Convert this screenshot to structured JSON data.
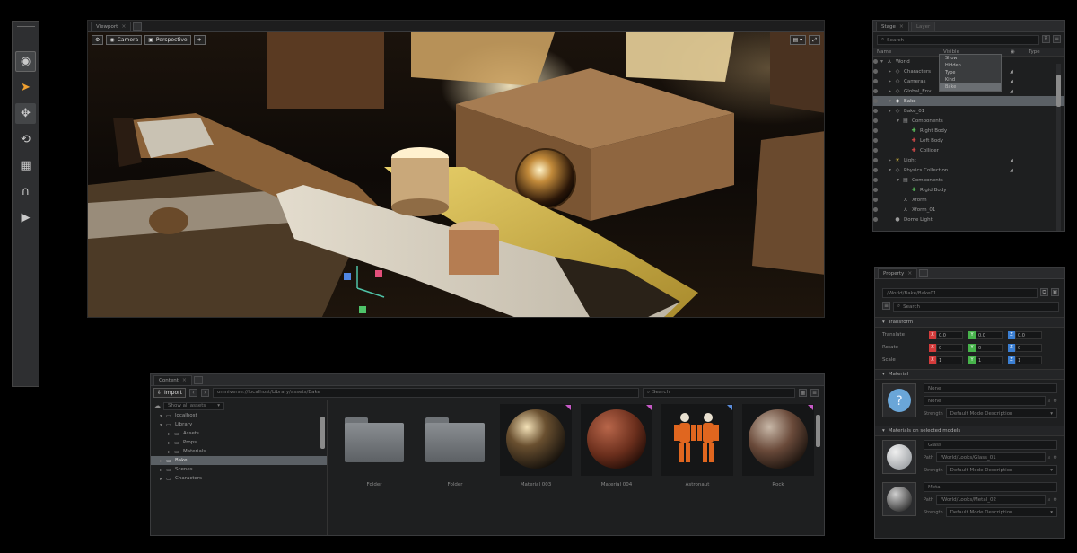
{
  "toolbar": {
    "tools": [
      {
        "name": "omniverse-logo-icon",
        "glyph": "◉"
      },
      {
        "name": "select-arrow-icon",
        "glyph": "➤"
      },
      {
        "name": "move-icon",
        "glyph": "✥"
      },
      {
        "name": "rotate-icon",
        "glyph": "⟲"
      },
      {
        "name": "scale-icon",
        "glyph": "▦"
      },
      {
        "name": "snap-magnet-icon",
        "glyph": "∩"
      },
      {
        "name": "play-icon",
        "glyph": "▶"
      }
    ]
  },
  "viewport": {
    "tab_label": "Viewport",
    "perspective_label": "Perspective",
    "camera_label": "Camera"
  },
  "stage": {
    "tab_label": "Stage",
    "tab2_label": "Layer",
    "search_placeholder": "Search",
    "columns": [
      "Name",
      "Visible",
      "Type"
    ],
    "rows": [
      {
        "label": "World",
        "icon": "⋏",
        "indent": 0,
        "exp": "▾"
      },
      {
        "label": "Characters",
        "icon": "◇",
        "indent": 1,
        "exp": "▸"
      },
      {
        "label": "Cameras",
        "icon": "◇",
        "indent": 1,
        "exp": "▸"
      },
      {
        "label": "Global_Env",
        "icon": "◇",
        "indent": 1,
        "exp": "▸"
      },
      {
        "label": "Bake",
        "icon": "◆",
        "indent": 1,
        "exp": "▾",
        "selected": true
      },
      {
        "label": "Bake_01",
        "icon": "◇",
        "indent": 1,
        "exp": "▾"
      },
      {
        "label": "Components",
        "icon": "▤",
        "indent": 2,
        "exp": "▾"
      },
      {
        "label": "Right Body",
        "icon": "✚",
        "indent": 3,
        "exp": ""
      },
      {
        "label": "Left Body",
        "icon": "✚",
        "indent": 3,
        "exp": ""
      },
      {
        "label": "Collider",
        "icon": "✚",
        "indent": 3,
        "exp": ""
      },
      {
        "label": "Light",
        "icon": "☀",
        "indent": 1,
        "exp": "▸"
      },
      {
        "label": "Physics Collection",
        "icon": "◇",
        "indent": 1,
        "exp": "▾"
      },
      {
        "label": "Components",
        "icon": "▤",
        "indent": 2,
        "exp": "▾"
      },
      {
        "label": "Rigid Body",
        "icon": "✚",
        "indent": 3,
        "exp": ""
      },
      {
        "label": "Xform",
        "icon": "⋏",
        "indent": 2,
        "exp": ""
      },
      {
        "label": "Xform_01",
        "icon": "⋏",
        "indent": 2,
        "exp": ""
      },
      {
        "label": "Dome Light",
        "icon": "●",
        "indent": 1,
        "exp": ""
      }
    ],
    "dropdown": [
      "Show",
      "Hidden",
      "Type",
      "Kind",
      "Bake"
    ]
  },
  "property": {
    "tab_label": "Property",
    "path_value": "/World/Bake/Bake01",
    "search_placeholder": "Search",
    "transform_title": "Transform",
    "transform_rows": [
      {
        "label": "Translate",
        "x": "0.0",
        "y": "0.0",
        "z": "0.0"
      },
      {
        "label": "Rotate",
        "x": "0",
        "y": "0",
        "z": "0"
      },
      {
        "label": "Scale",
        "x": "1",
        "y": "1",
        "z": "1"
      }
    ],
    "material_title": "Material",
    "material_name": "None",
    "material_mode": "None",
    "strength_label": "Strength",
    "strength_value": "Default Mode Description",
    "bound_title": "Materials on selected models",
    "bound": [
      {
        "name": "Glass",
        "path_label": "Path",
        "path": "/World/Looks/Glass_01",
        "strength": "Default Mode Description"
      },
      {
        "name": "Metal",
        "path_label": "Path",
        "path": "/World/Looks/Metal_02",
        "strength": "Default Mode Description"
      }
    ]
  },
  "content": {
    "tab_label": "Content",
    "import_label": "Import",
    "path_value": "omniverse://localhost/Library/assets/Bake",
    "search_placeholder": "Search",
    "filter_label": "Show all assets",
    "tree": [
      {
        "label": "localhost",
        "indent": 0,
        "exp": "▾"
      },
      {
        "label": "Library",
        "indent": 0,
        "exp": "▾"
      },
      {
        "label": "Assets",
        "indent": 1,
        "exp": "▸"
      },
      {
        "label": "Props",
        "indent": 1,
        "exp": "▸"
      },
      {
        "label": "Materials",
        "indent": 1,
        "exp": "▸"
      },
      {
        "label": "Bake",
        "indent": 0,
        "exp": "▸",
        "selected": true
      },
      {
        "label": "Scenes",
        "indent": 0,
        "exp": "▸"
      },
      {
        "label": "Characters",
        "indent": 0,
        "exp": "▸"
      }
    ],
    "assets": [
      {
        "label": "Folder",
        "kind": "folder",
        "corner": ""
      },
      {
        "label": "Folder",
        "kind": "folder",
        "corner": ""
      },
      {
        "label": "Material 003",
        "kind": "glass",
        "corner": "pink"
      },
      {
        "label": "Material 004",
        "kind": "leather",
        "corner": "pink"
      },
      {
        "label": "Astronaut",
        "kind": "figure",
        "corner": "blue"
      },
      {
        "label": "Rock",
        "kind": "rock",
        "corner": "pink"
      }
    ]
  }
}
